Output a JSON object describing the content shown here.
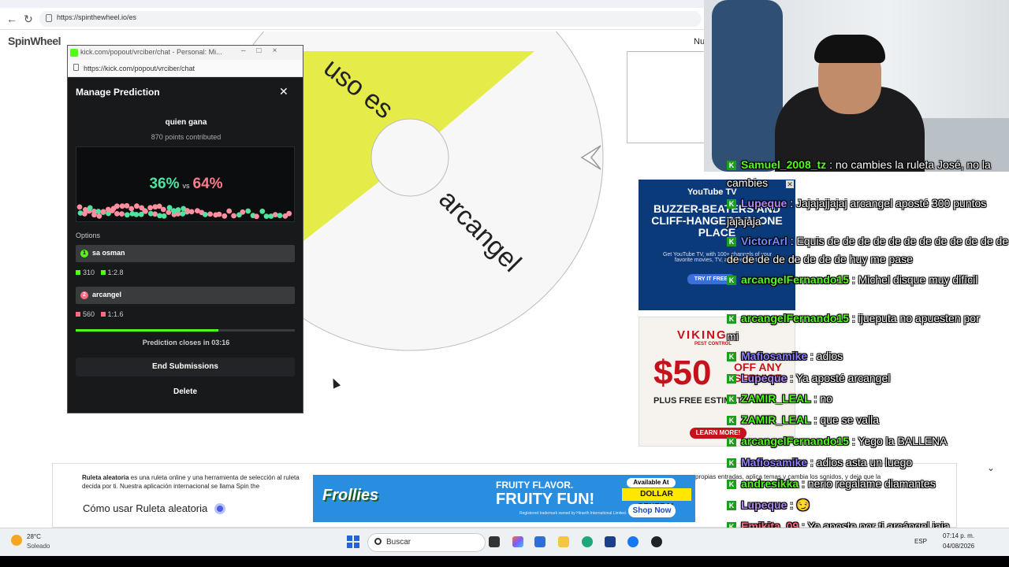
{
  "browser": {
    "url": "https://spinthewheel.io/es"
  },
  "site": {
    "logo": "SpinWheel",
    "partial_nav": "Nu",
    "wheel_segments": [
      "uso es",
      "arcangel"
    ],
    "colors": {
      "wheel_yellow": "#e5ec4a",
      "wheel_white": "#f7f7f7"
    },
    "desc_bold": "Ruleta aleatoria",
    "desc_text": " es una ruleta online y una herramienta de selección al ruleta decida por ti. Nuestra aplicación internacional se llama Spin the",
    "desc_text_right": "propias entradas, aplica temas y cambia los sonidos, y deja que la",
    "how_title": "Cómo usar Ruleta aleatoria"
  },
  "ad_banner": {
    "brand": "Frollies",
    "flavor": "FRUITY FLAVOR.",
    "headline": "FRUITY FUN!",
    "small": "Registered trademark owned by Hiraeth International Limited.",
    "available": "Available At",
    "store": "DOLLAR GENERAL",
    "shop": "Shop Now"
  },
  "kick": {
    "window_title": "kick.com/popout/vrciber/chat - Personal: Mi...",
    "url": "https://kick.com/popout/vrciber/chat",
    "modal_title": "Manage Prediction",
    "question": "quien gana",
    "points": "870 points contributed",
    "pct_a": "36%",
    "vs": "vs",
    "pct_b": "64%",
    "options_header": "Options",
    "options": [
      {
        "num": "1",
        "label": "sa osman",
        "points": "310",
        "ratio": "1:2.8",
        "color": "#53fc18"
      },
      {
        "num": "2",
        "label": "arcangel",
        "points": "560",
        "ratio": "1:1.6",
        "color": "#ff6b81"
      }
    ],
    "progress": 0.65,
    "closes": "Prediction closes in 03:16",
    "end_button": "End Submissions",
    "delete_button": "Delete"
  },
  "ads_right": {
    "yt_logo": "YouTube TV",
    "yt_head": "BUZZER-BEATERS AND CLIFF-HANGERS IN ONE PLACE",
    "yt_sub": "Get YouTube TV, with 100+ channels of your favorite movies, TV, and live sports",
    "yt_try": "TRY IT FREE",
    "vk_logo": "VIKING",
    "vk_pest": "PEST CONTROL",
    "vk_50": "$50",
    "vk_off": "OFF ANY SERVICE",
    "vk_plus": "PLUS FREE ESTIMATE",
    "vk_learn": "LEARN MORE!"
  },
  "chat": [
    {
      "user": "Samuel_2008_tz",
      "color": "#53fc18",
      "msg": " : no cambies la ruleta José, no la"
    },
    {
      "user": "",
      "color": "#ffffff",
      "msg": "cambies"
    },
    {
      "user": "Lupeque",
      "color": "#b085f5",
      "msg": " : Jajajajjajaj arcangel aposté 300 puntos"
    },
    {
      "user": "",
      "color": "#ffffff",
      "msg": "jajajaja"
    },
    {
      "user": "VictorArl",
      "color": "#6a8cff",
      "msg": " : Equis de de de de de de de de de de de de"
    },
    {
      "user": "",
      "color": "#ffffff",
      "msg": "de de de de de de de de huy me pase"
    },
    {
      "user": "arcangelFernando15",
      "color": "#53fc18",
      "msg": " : Michel disque muy difícil"
    },
    {
      "user": "arcangelFernando15",
      "color": "#53fc18",
      "msg": " : ijueputa no apuesten por"
    },
    {
      "user": "",
      "color": "#ffffff",
      "msg": "mi"
    },
    {
      "user": "Mafiosamike",
      "color": "#8f7dff",
      "msg": " : adios"
    },
    {
      "user": "Lupeque",
      "color": "#b085f5",
      "msg": " : Ya aposté arcangel"
    },
    {
      "user": "ZAMIR_LEAL",
      "color": "#53fc18",
      "msg": " : no"
    },
    {
      "user": "ZAMIR_LEAL",
      "color": "#53fc18",
      "msg": " : que se valla"
    },
    {
      "user": "arcangelFernando15",
      "color": "#53fc18",
      "msg": " : Yego la BALLENA"
    },
    {
      "user": "Mafiosamike",
      "color": "#8f7dff",
      "msg": " : adios asta un luego"
    },
    {
      "user": "andresikka",
      "color": "#53fc18",
      "msg": " : nerio regalame diamantes"
    },
    {
      "user": "Lupeque",
      "color": "#b085f5",
      "msg": " : 😏"
    },
    {
      "user": "Emikita_09",
      "color": "#ff6b81",
      "msg": " : Yo aposte por ti arcángel jaja"
    }
  ],
  "taskbar": {
    "temp": "28°C",
    "condition": "Soleado",
    "search": "Buscar",
    "lang": "ESP",
    "time": "07:14 p. m.",
    "date": "04/08/2026"
  }
}
